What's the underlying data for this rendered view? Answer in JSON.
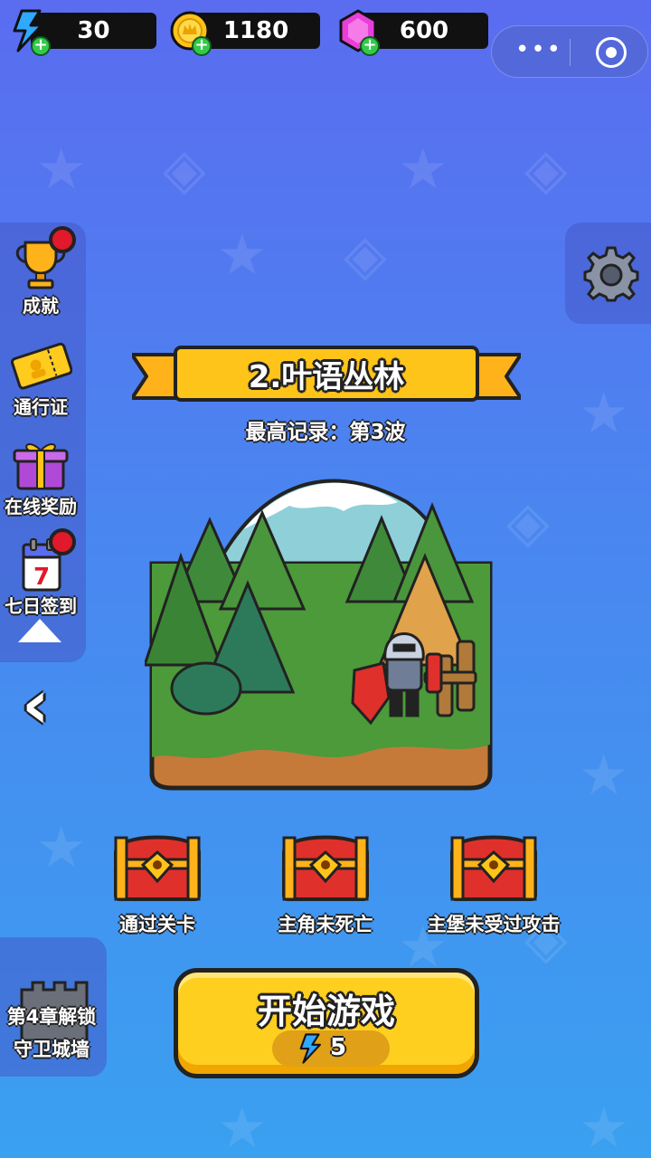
{
  "resources": {
    "energy": "30",
    "coins": "1180",
    "gems": "600"
  },
  "side_menu": {
    "achievements": "成就",
    "pass": "通行证",
    "online_rewards": "在线奖励",
    "seven_day_checkin": "七日签到"
  },
  "level": {
    "title": "2.叶语丛林",
    "record": "最高记录：第3波"
  },
  "rewards": [
    {
      "label": "通过关卡"
    },
    {
      "label": "主角未死亡"
    },
    {
      "label": "主堡未受过攻击"
    }
  ],
  "chapter_unlock": {
    "line1": "第4章解锁",
    "line2": "守卫城墙"
  },
  "start_button": {
    "label": "开始游戏",
    "cost": "5"
  },
  "calendar_day": "7",
  "colors": {
    "accent_yellow": "#ffc41a",
    "energy_blue": "#2fa8ff",
    "coin_gold": "#ffc21a",
    "gem_magenta": "#e83fd8",
    "badge_red": "#e0192b"
  }
}
